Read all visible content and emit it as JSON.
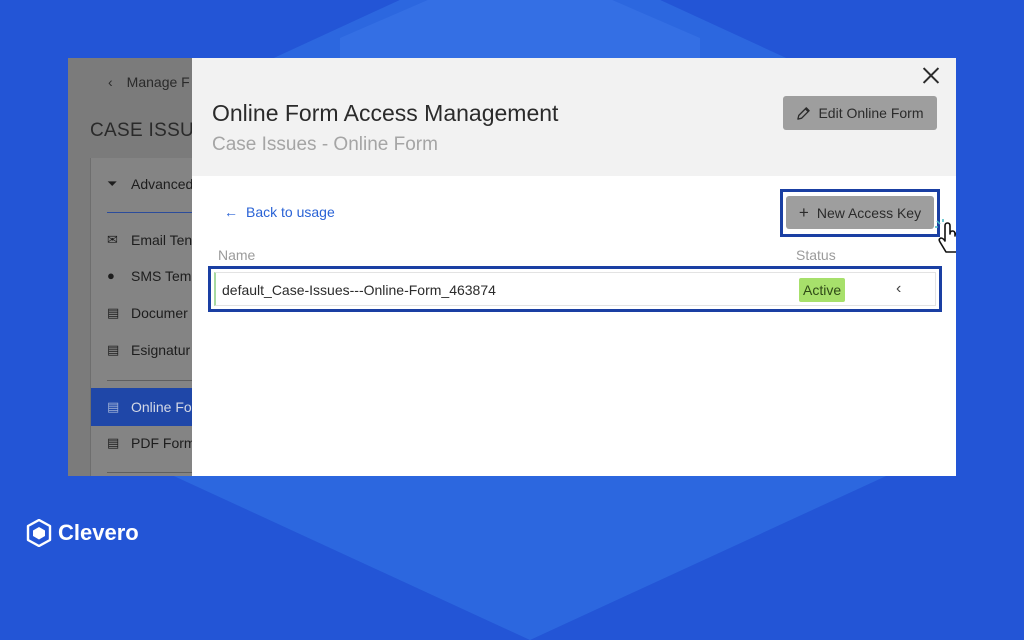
{
  "background": {
    "color": "#2355d6",
    "accent": "#2e6be0"
  },
  "underlying_page": {
    "back_label": "Manage F",
    "case_title": "CASE ISSUI",
    "sidebar_items": [
      {
        "label": "Advanced",
        "icon": "filter-icon"
      },
      {
        "label": "Email Ten",
        "icon": "envelope-icon"
      },
      {
        "label": "SMS Tem",
        "icon": "chat-bubble-icon"
      },
      {
        "label": "Documer",
        "icon": "document-icon"
      },
      {
        "label": "Esignatur",
        "icon": "pdf-file-icon"
      },
      {
        "label": "Online Fo",
        "icon": "form-file-icon",
        "selected": true
      },
      {
        "label": "PDF Form",
        "icon": "pdf-form-icon"
      }
    ]
  },
  "modal": {
    "title": "Online Form Access Management",
    "subtitle": "Case Issues - Online Form",
    "edit_button": "Edit Online Form",
    "back_link": "Back to usage",
    "new_key_button": "New Access Key",
    "table": {
      "headers": {
        "name": "Name",
        "status": "Status"
      },
      "rows": [
        {
          "name": "default_Case-Issues---Online-Form_463874",
          "status": "Active"
        }
      ]
    }
  },
  "brand": {
    "name": "Clevero"
  }
}
